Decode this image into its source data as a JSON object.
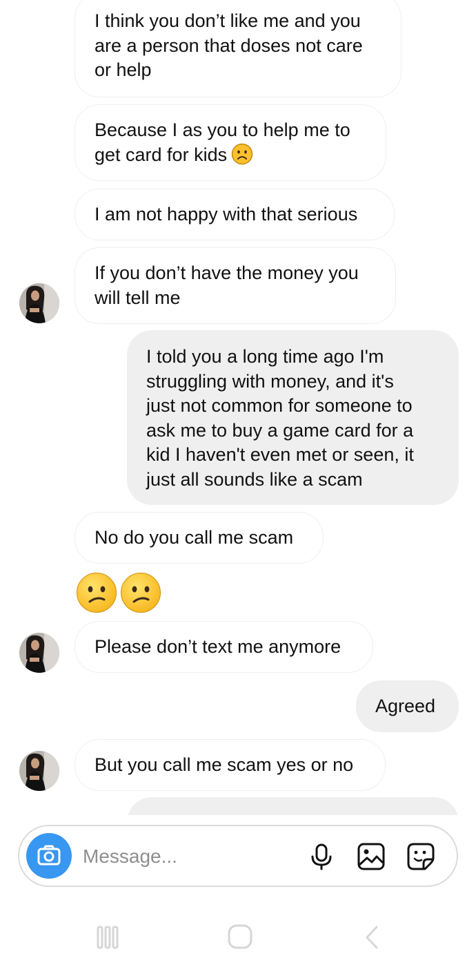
{
  "messages": [
    {
      "direction": "incoming",
      "lines": [
        "I think you don’t like me and you",
        "are a person that doses not care",
        "or help"
      ]
    },
    {
      "direction": "incoming",
      "lines": [
        "Because I as you to help me to",
        "get card for kids"
      ],
      "emoji": "frowning-face"
    },
    {
      "direction": "incoming",
      "lines": [
        "I am not happy with that serious"
      ]
    },
    {
      "direction": "incoming",
      "lines": [
        "If you don’t have the money you",
        "will tell me"
      ]
    },
    {
      "direction": "outgoing",
      "lines": [
        "I told you a long time ago I'm",
        "struggling with money, and it's",
        "just not common for someone to",
        "ask me to buy a game card for a",
        "kid I haven't even met or seen, it",
        "just all sounds like a scam"
      ]
    },
    {
      "direction": "incoming",
      "lines": [
        "No do you call me scam"
      ]
    },
    {
      "direction": "incoming",
      "emoji_only": [
        "confused-face",
        "confused-face"
      ]
    },
    {
      "direction": "incoming",
      "lines": [
        "Please don’t text me anymore"
      ]
    },
    {
      "direction": "outgoing",
      "lines": [
        "Agreed"
      ]
    },
    {
      "direction": "incoming",
      "lines": [
        "But you call me scam yes or no"
      ]
    }
  ],
  "composer": {
    "placeholder": "Message...",
    "camera_icon": "camera-icon",
    "mic_icon": "microphone-icon",
    "gallery_icon": "gallery-icon",
    "sticker_icon": "sticker-icon",
    "accent_color": "#3897f0"
  },
  "navigation": {
    "recent_icon": "recent-apps-icon",
    "home_icon": "home-icon",
    "back_icon": "back-icon"
  },
  "colors": {
    "outgoing_bubble": "#efefef",
    "incoming_border": "#efefef",
    "composer_border": "#dbdbdb"
  }
}
